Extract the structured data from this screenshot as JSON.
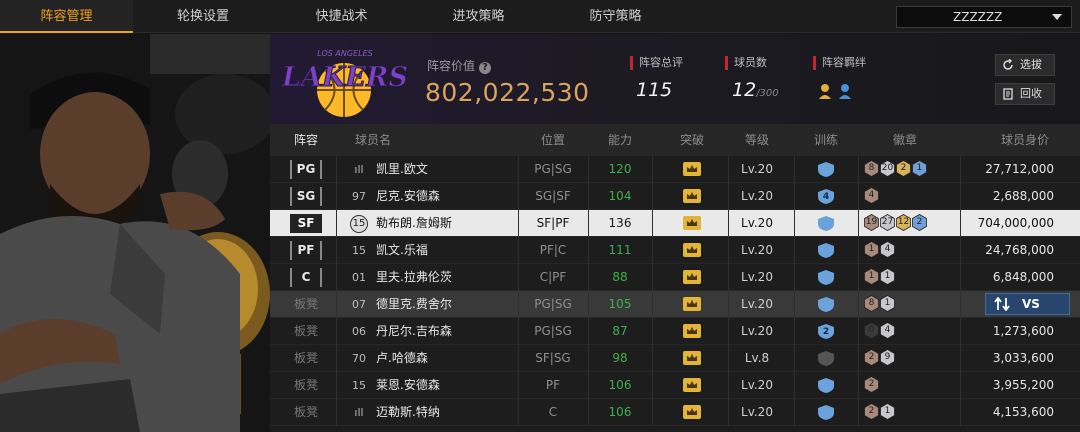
{
  "tabs": [
    {
      "label": "阵容管理",
      "active": true
    },
    {
      "label": "轮换设置",
      "active": false
    },
    {
      "label": "快捷战术",
      "active": false
    },
    {
      "label": "进攻策略",
      "active": false
    },
    {
      "label": "防守策略",
      "active": false
    }
  ],
  "team_select": {
    "value": "ZZZZZZ"
  },
  "logo": {
    "team_text": "LOS ANGELES",
    "brand_text": "LAKERS"
  },
  "header": {
    "value_label": "阵容价值",
    "value": "802,022,530",
    "rating_label": "阵容总评",
    "rating": "115",
    "count_label": "球员数",
    "count": "12",
    "count_max": "/300",
    "bond_label": "阵容羁绊",
    "select_button": "选拔",
    "recycle_button": "回收"
  },
  "columns": [
    "阵容",
    "球员名",
    "位置",
    "能力",
    "突破",
    "等级",
    "训练",
    "徽章",
    "球员身价"
  ],
  "rows": [
    {
      "slot": "PG",
      "bench": false,
      "num": "ıll",
      "name": "凯里.欧文",
      "pos": "PG|SG",
      "ability": "120",
      "ability_green": true,
      "level": "Lv.20",
      "train": "blue",
      "train_text": "",
      "badges": [
        {
          "v": "8",
          "c": "bronze"
        },
        {
          "v": "20",
          "c": "silver"
        },
        {
          "v": "2",
          "c": "gold"
        },
        {
          "v": "1",
          "c": "blue"
        }
      ],
      "worth": "27,712,000"
    },
    {
      "slot": "SG",
      "bench": false,
      "num": "97",
      "name": "尼克.安德森",
      "pos": "SG|SF",
      "ability": "104",
      "ability_green": true,
      "level": "Lv.20",
      "train": "blue",
      "train_text": "4",
      "badges": [
        {
          "v": "4",
          "c": "bronze"
        }
      ],
      "worth": "2,688,000"
    },
    {
      "slot": "SF",
      "bench": false,
      "selected": true,
      "num": "15",
      "name": "勒布朗.詹姆斯",
      "pos": "SF|PF",
      "ability": "136",
      "ability_green": false,
      "level": "Lv.20",
      "train": "blue",
      "train_text": "",
      "badges": [
        {
          "v": "19",
          "c": "bronze"
        },
        {
          "v": "27",
          "c": "silver"
        },
        {
          "v": "12",
          "c": "gold"
        },
        {
          "v": "2",
          "c": "blue"
        }
      ],
      "worth": "704,000,000"
    },
    {
      "slot": "PF",
      "bench": false,
      "num": "15",
      "name": "凯文.乐福",
      "pos": "PF|C",
      "ability": "111",
      "ability_green": true,
      "level": "Lv.20",
      "train": "blue",
      "train_text": "",
      "badges": [
        {
          "v": "1",
          "c": "bronze"
        },
        {
          "v": "4",
          "c": "silver"
        }
      ],
      "worth": "24,768,000"
    },
    {
      "slot": "C",
      "bench": false,
      "num": "01",
      "name": "里夫.拉弗伦茨",
      "pos": "C|PF",
      "ability": "88",
      "ability_green": true,
      "level": "Lv.20",
      "train": "blue",
      "train_text": "",
      "badges": [
        {
          "v": "1",
          "c": "bronze"
        },
        {
          "v": "1",
          "c": "silver"
        }
      ],
      "worth": "6,848,000"
    },
    {
      "slot": "板凳",
      "bench": true,
      "highlight": true,
      "num": "07",
      "name": "德里克.费舍尔",
      "pos": "PG|SG",
      "ability": "105",
      "ability_green": true,
      "level": "Lv.20",
      "train": "blue",
      "train_text": "",
      "badges": [
        {
          "v": "8",
          "c": "bronze"
        },
        {
          "v": "1",
          "c": "silver"
        }
      ],
      "worth": ""
    },
    {
      "slot": "板凳",
      "bench": true,
      "num": "06",
      "name": "丹尼尔.吉布森",
      "pos": "PG|SG",
      "ability": "87",
      "ability_green": true,
      "level": "Lv.20",
      "train": "blue",
      "train_text": "2",
      "badges": [
        {
          "v": "0",
          "c": "dark"
        },
        {
          "v": "4",
          "c": "silver"
        }
      ],
      "worth": "1,273,600"
    },
    {
      "slot": "板凳",
      "bench": true,
      "num": "70",
      "name": "卢.哈德森",
      "pos": "SF|SG",
      "ability": "98",
      "ability_green": true,
      "level": "Lv.8",
      "train": "gray",
      "train_text": "",
      "badges": [
        {
          "v": "2",
          "c": "bronze"
        },
        {
          "v": "9",
          "c": "silver"
        }
      ],
      "worth": "3,033,600"
    },
    {
      "slot": "板凳",
      "bench": true,
      "num": "15",
      "name": "莱恩.安德森",
      "pos": "PF",
      "ability": "106",
      "ability_green": true,
      "level": "Lv.20",
      "train": "blue",
      "train_text": "",
      "badges": [
        {
          "v": "2",
          "c": "bronze"
        }
      ],
      "worth": "3,955,200"
    },
    {
      "slot": "板凳",
      "bench": true,
      "num": "ıll",
      "name": "迈勒斯.特纳",
      "pos": "C",
      "ability": "106",
      "ability_green": true,
      "level": "Lv.20",
      "train": "blue",
      "train_text": "",
      "badges": [
        {
          "v": "2",
          "c": "bronze"
        },
        {
          "v": "1",
          "c": "silver"
        }
      ],
      "worth": "4,153,600"
    }
  ],
  "vs_button": {
    "label": "VS"
  },
  "colors": {
    "accent": "#f0a020",
    "value": "#d9a35d",
    "green": "#3fae49",
    "lakers_purple": "#552583",
    "lakers_gold": "#fdb927"
  }
}
